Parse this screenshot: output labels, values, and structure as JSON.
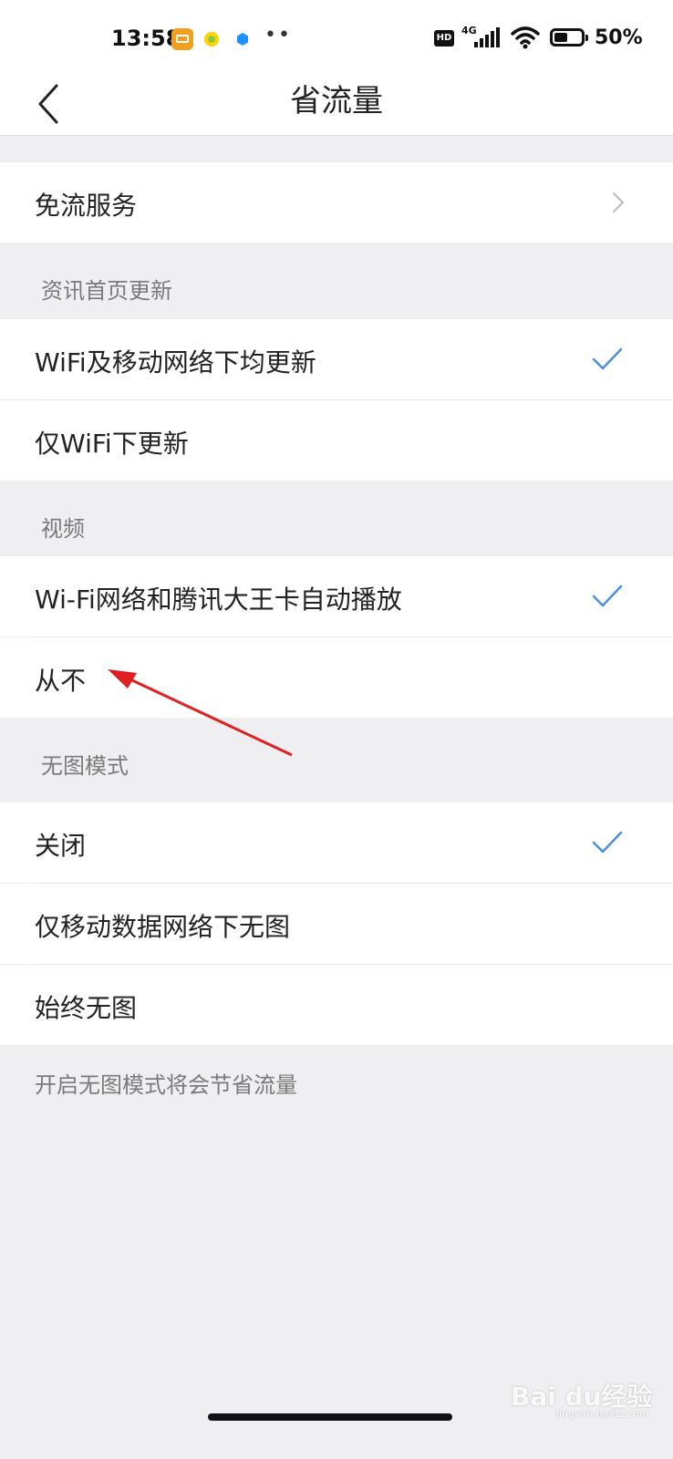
{
  "status_bar": {
    "time": "13:58",
    "dots": "••",
    "hd": "HD",
    "network": "4G",
    "battery": "50%"
  },
  "nav": {
    "title": "省流量"
  },
  "free_service": {
    "label": "免流服务"
  },
  "sections": {
    "news": {
      "header": "资讯首页更新",
      "options": [
        "WiFi及移动网络下均更新",
        "仅WiFi下更新"
      ],
      "selected_index": 0
    },
    "video": {
      "header": "视频",
      "options": [
        "Wi-Fi网络和腾讯大王卡自动播放",
        "从不"
      ],
      "selected_index": 0
    },
    "no_image": {
      "header": "无图模式",
      "options": [
        "关闭",
        "仅移动数据网络下无图",
        "始终无图"
      ],
      "selected_index": 0
    }
  },
  "footer_note": "开启无图模式将会节省流量",
  "watermark": {
    "brand": "Bai du经验",
    "url": "jingyan.baidu.com"
  },
  "colors": {
    "check": "#4a90d9",
    "annotation_arrow": "#e02020",
    "background": "#efeff1"
  }
}
